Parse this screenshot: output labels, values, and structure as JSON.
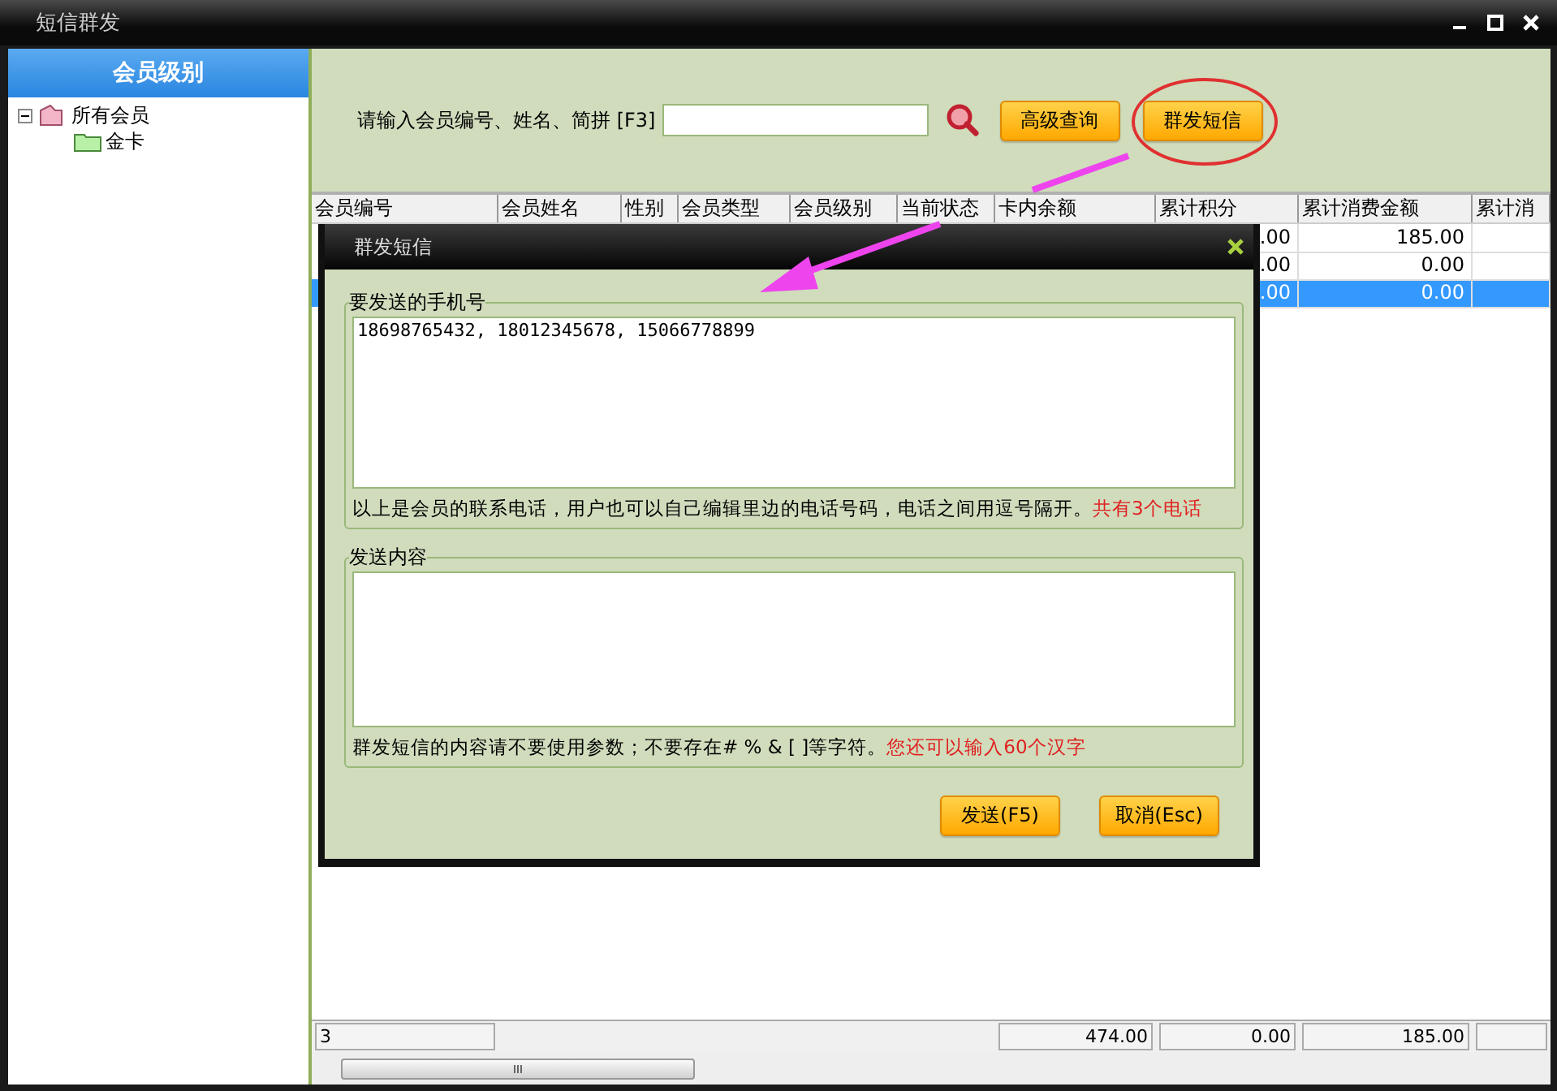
{
  "window": {
    "title": "短信群发"
  },
  "sidebar": {
    "header": "会员级别",
    "tree": [
      {
        "label": "所有会员",
        "expanded": true,
        "children": [
          {
            "label": "金卡"
          }
        ]
      }
    ]
  },
  "toolbar": {
    "search_label": "请输入会员编号、姓名、简拼 [F3]",
    "buttons": [
      {
        "label": "高级查询",
        "highlighted": false
      },
      {
        "label": "群发短信",
        "highlighted": true
      }
    ]
  },
  "table": {
    "columns": [
      "会员编号",
      "会员姓名",
      "性别",
      "会员类型",
      "会员级别",
      "当前状态",
      "卡内余额",
      "累计积分",
      "累计消费金额",
      "累计消"
    ],
    "rows": [
      {
        "selected": false,
        "points": ".00",
        "total_spent": "185.00"
      },
      {
        "selected": false,
        "points": ".00",
        "total_spent": "0.00"
      },
      {
        "selected": true,
        "points": ".00",
        "total_spent": "0.00"
      }
    ],
    "footer": {
      "count": "3",
      "totals": [
        "474.00",
        "0.00",
        "185.00"
      ]
    }
  },
  "dialog": {
    "title": "群发短信",
    "phones": {
      "legend": "要发送的手机号",
      "value": "18698765432, 18012345678, 15066778899",
      "note": "以上是会员的联系电话，用户也可以自己编辑里边的电话号码，电话之间用逗号隔开。",
      "note_alert": "共有3个电话"
    },
    "content": {
      "legend": "发送内容",
      "note": "群发短信的内容请不要使用参数；不要存在# % & [ ]等字符。",
      "note_alert": "您还可以输入60个汉字"
    },
    "buttons": [
      "发送(F5)",
      "取消(Esc)"
    ]
  }
}
